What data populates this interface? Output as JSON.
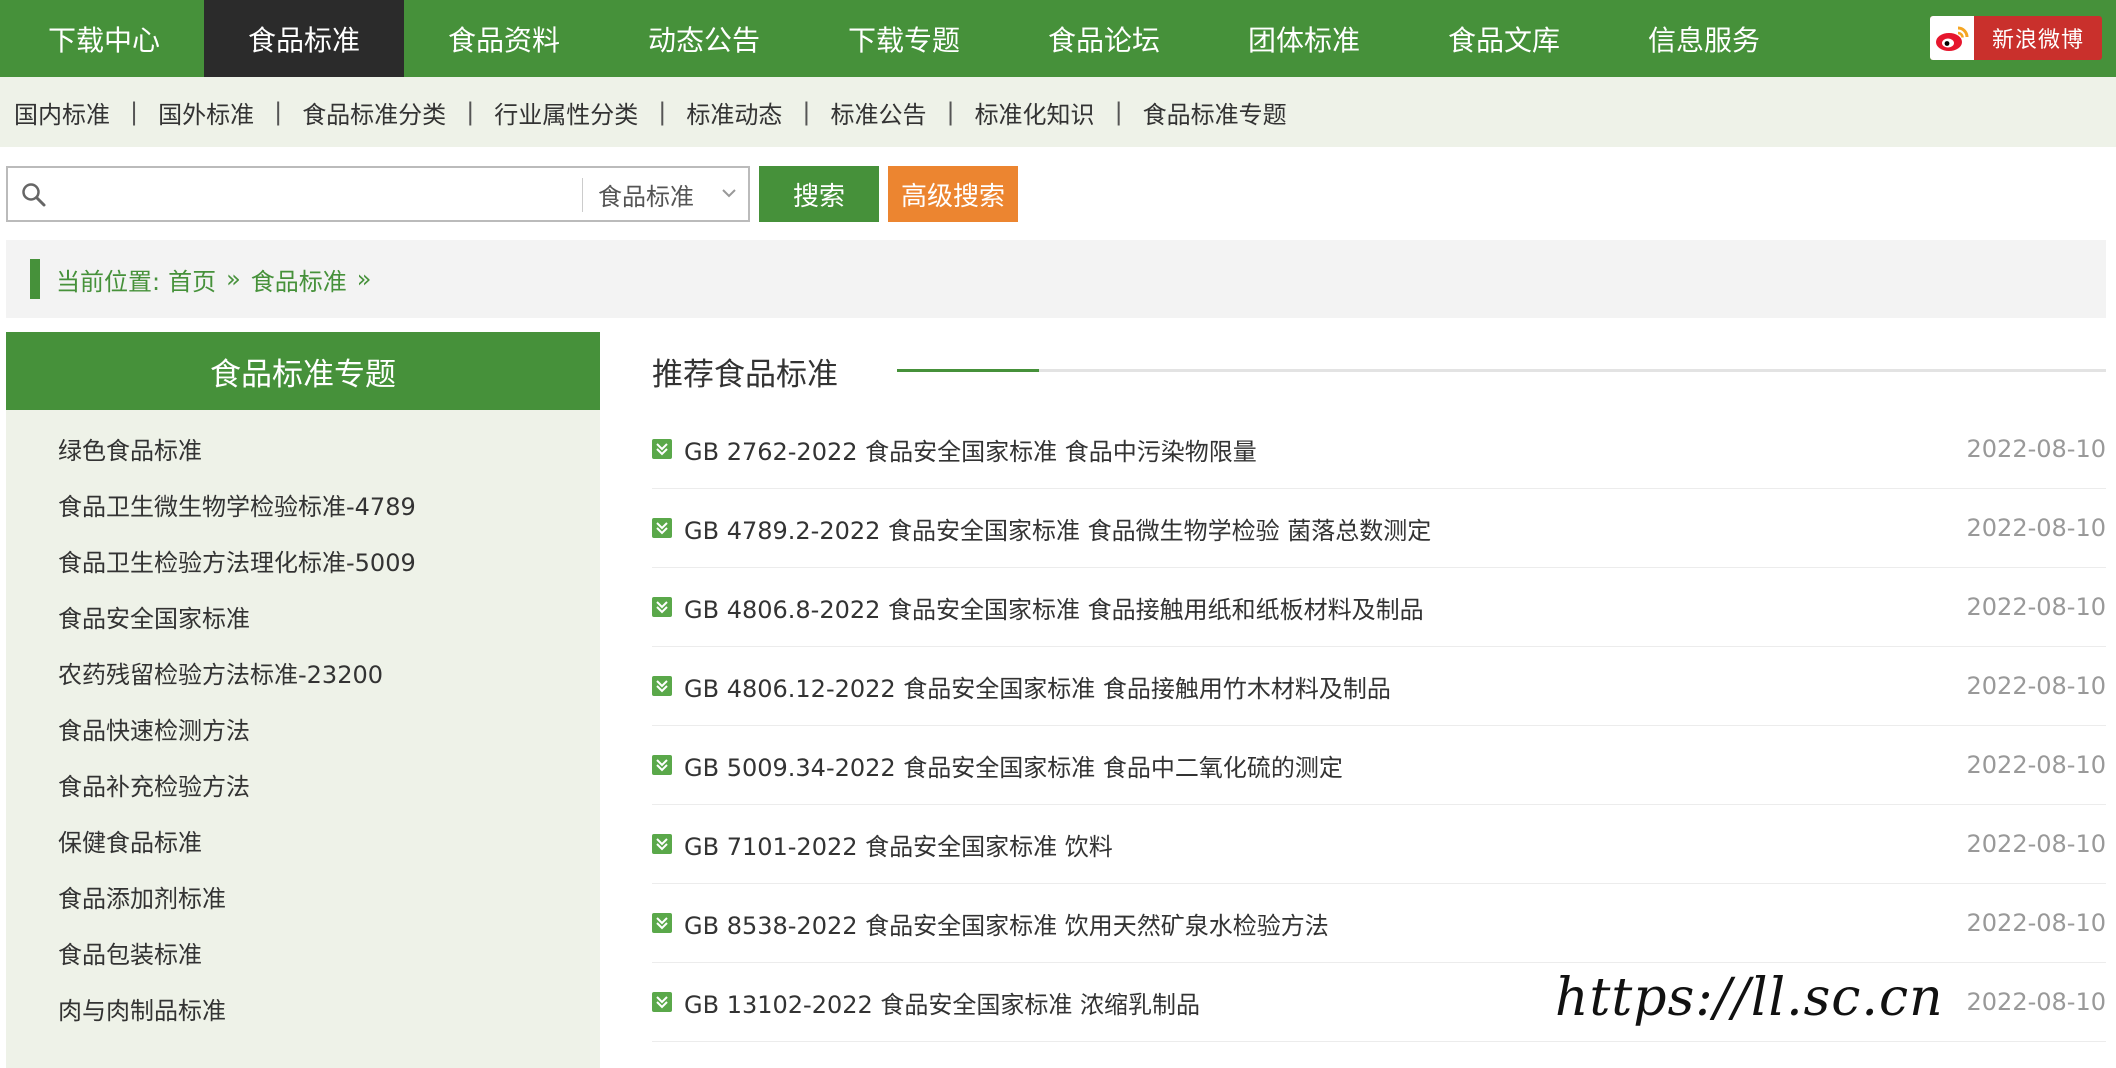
{
  "topnav": {
    "items": [
      {
        "label": "下载中心",
        "active": false
      },
      {
        "label": "食品标准",
        "active": true
      },
      {
        "label": "食品资料",
        "active": false
      },
      {
        "label": "动态公告",
        "active": false
      },
      {
        "label": "下载专题",
        "active": false
      },
      {
        "label": "食品论坛",
        "active": false
      },
      {
        "label": "团体标准",
        "active": false
      },
      {
        "label": "食品文库",
        "active": false
      },
      {
        "label": "信息服务",
        "active": false
      }
    ],
    "weibo_label": "新浪微博",
    "weibo_icon": "weibo-icon"
  },
  "subnav": {
    "items": [
      "国内标准",
      "国外标准",
      "食品标准分类",
      "行业属性分类",
      "标准动态",
      "标准公告",
      "标准化知识",
      "食品标准专题"
    ],
    "separator": "|"
  },
  "search": {
    "value": "",
    "placeholder": "",
    "category": "食品标准",
    "search_button": "搜索",
    "advanced_button": "高级搜索"
  },
  "breadcrumb": {
    "prefix": "当前位置:",
    "home": "首页",
    "current": "食品标准",
    "separator": "»"
  },
  "sidebar": {
    "title": "食品标准专题",
    "items": [
      "绿色食品标准",
      "食品卫生微生物学检验标准-4789",
      "食品卫生检验方法理化标准-5009",
      "食品安全国家标准",
      "农药残留检验方法标准-23200",
      "食品快速检测方法",
      "食品补充检验方法",
      "保健食品标准",
      "食品添加剂标准",
      "食品包装标准",
      "肉与肉制品标准"
    ]
  },
  "main": {
    "title": "推荐食品标准",
    "list": [
      {
        "title": "GB 2762-2022 食品安全国家标准 食品中污染物限量",
        "date": "2022-08-10"
      },
      {
        "title": "GB 4789.2-2022 食品安全国家标准 食品微生物学检验 菌落总数测定",
        "date": "2022-08-10"
      },
      {
        "title": "GB 4806.8-2022 食品安全国家标准 食品接触用纸和纸板材料及制品",
        "date": "2022-08-10"
      },
      {
        "title": "GB 4806.12-2022 食品安全国家标准 食品接触用竹木材料及制品",
        "date": "2022-08-10"
      },
      {
        "title": "GB 5009.34-2022 食品安全国家标准 食品中二氧化硫的测定",
        "date": "2022-08-10"
      },
      {
        "title": "GB 7101-2022 食品安全国家标准 饮料",
        "date": "2022-08-10"
      },
      {
        "title": "GB 8538-2022 食品安全国家标准 饮用天然矿泉水检验方法",
        "date": "2022-08-10"
      },
      {
        "title": "GB 13102-2022 食品安全国家标准 浓缩乳制品",
        "date": "2022-08-10"
      }
    ]
  },
  "watermark": "https://ll.sc.cn",
  "colors": {
    "brand_green": "#46913a",
    "active_nav": "#2b2b2b",
    "advanced_orange": "#ec8530",
    "weibo_red": "#c9302c",
    "light_bg": "#eef2e8"
  }
}
